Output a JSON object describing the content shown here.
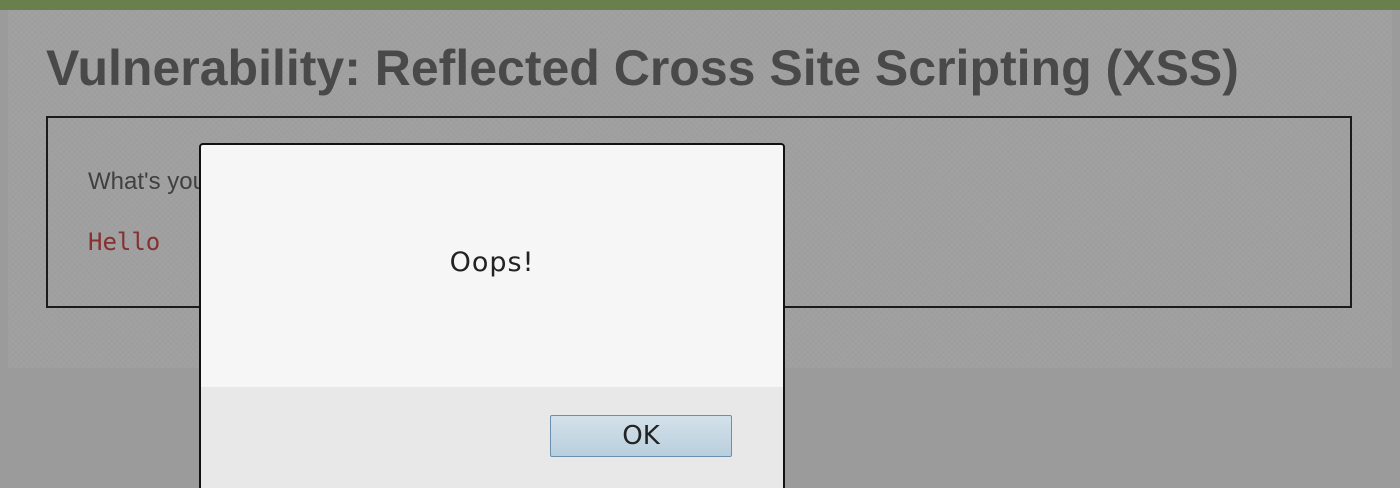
{
  "page": {
    "title": "Vulnerability: Reflected Cross Site Scripting (XSS)",
    "prompt_label": "What's your name?",
    "output_text": "Hello"
  },
  "alert": {
    "message": "Oops!",
    "ok_label": "OK"
  },
  "colors": {
    "header_bar": "#8fb65b",
    "output_text": "#c02828",
    "ok_button": "#c7d9e5"
  }
}
